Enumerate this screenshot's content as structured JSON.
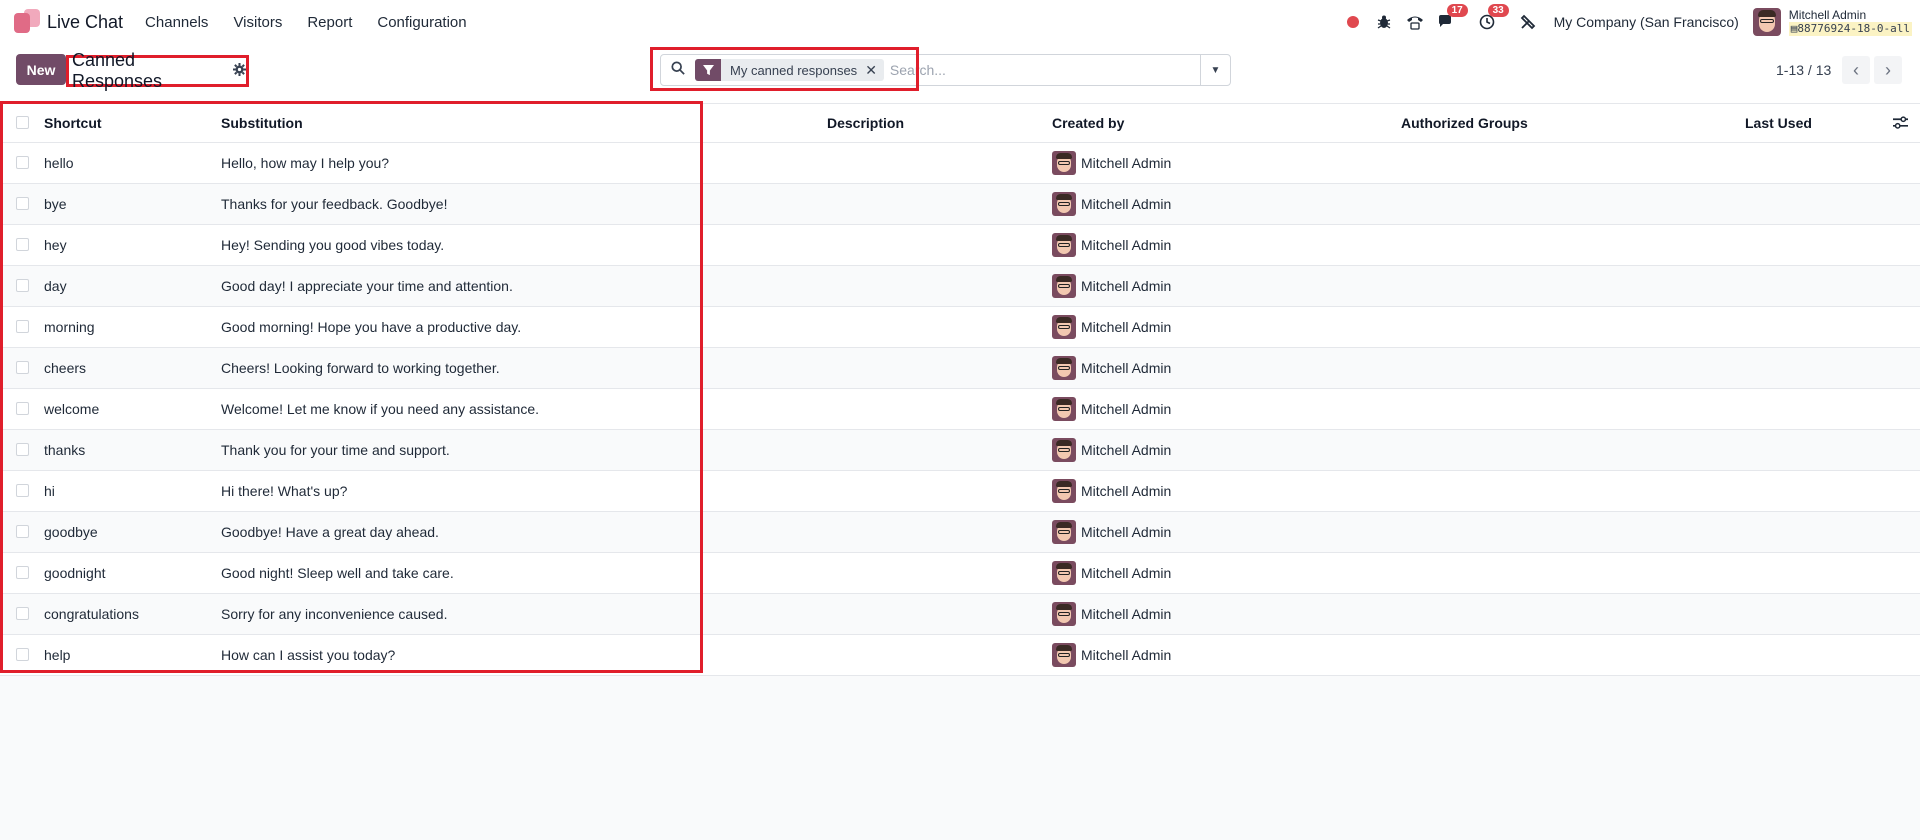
{
  "navbar": {
    "app_name": "Live Chat",
    "menu": [
      "Channels",
      "Visitors",
      "Report",
      "Configuration"
    ],
    "messages_badge": "17",
    "activities_badge": "33",
    "company": "My Company (San Francisco)",
    "user_name": "Mitchell Admin",
    "database": "88776924-18-0-all"
  },
  "control": {
    "new_label": "New",
    "title": "Canned Responses",
    "facet_label": "My canned responses",
    "search_placeholder": "Search...",
    "pager": "1-13 / 13"
  },
  "columns": {
    "shortcut": "Shortcut",
    "substitution": "Substitution",
    "description": "Description",
    "created_by": "Created by",
    "groups": "Authorized Groups",
    "last_used": "Last Used"
  },
  "rows": [
    {
      "shortcut": "hello",
      "substitution": "Hello, how may I help you?",
      "created_by": "Mitchell Admin"
    },
    {
      "shortcut": "bye",
      "substitution": "Thanks for your feedback. Goodbye!",
      "created_by": "Mitchell Admin"
    },
    {
      "shortcut": "hey",
      "substitution": "Hey! Sending you good vibes today.",
      "created_by": "Mitchell Admin"
    },
    {
      "shortcut": "day",
      "substitution": "Good day! I appreciate your time and attention.",
      "created_by": "Mitchell Admin"
    },
    {
      "shortcut": "morning",
      "substitution": "Good morning! Hope you have a productive day.",
      "created_by": "Mitchell Admin"
    },
    {
      "shortcut": "cheers",
      "substitution": "Cheers! Looking forward to working together.",
      "created_by": "Mitchell Admin"
    },
    {
      "shortcut": "welcome",
      "substitution": "Welcome! Let me know if you need any assistance.",
      "created_by": "Mitchell Admin"
    },
    {
      "shortcut": "thanks",
      "substitution": "Thank you for your time and support.",
      "created_by": "Mitchell Admin"
    },
    {
      "shortcut": "hi",
      "substitution": "Hi there! What's up?",
      "created_by": "Mitchell Admin"
    },
    {
      "shortcut": "goodbye",
      "substitution": "Goodbye! Have a great day ahead.",
      "created_by": "Mitchell Admin"
    },
    {
      "shortcut": "goodnight",
      "substitution": "Good night! Sleep well and take care.",
      "created_by": "Mitchell Admin"
    },
    {
      "shortcut": "congratulations",
      "substitution": "Sorry for any inconvenience caused.",
      "created_by": "Mitchell Admin"
    },
    {
      "shortcut": "help",
      "substitution": "How can I assist you today?",
      "created_by": "Mitchell Admin"
    }
  ],
  "icons": {
    "record": "record-dot-icon",
    "debug": "bug-icon",
    "phone": "phone-icon",
    "messages": "chat-icon",
    "activities": "clock-icon",
    "tools": "tools-icon",
    "settings": "gear-icon",
    "search": "search-icon",
    "filter": "filter-icon",
    "optional_columns": "sliders-icon"
  },
  "colors": {
    "brand": "#714b67",
    "highlight": "#e01e2b",
    "badge": "#e0484f"
  }
}
